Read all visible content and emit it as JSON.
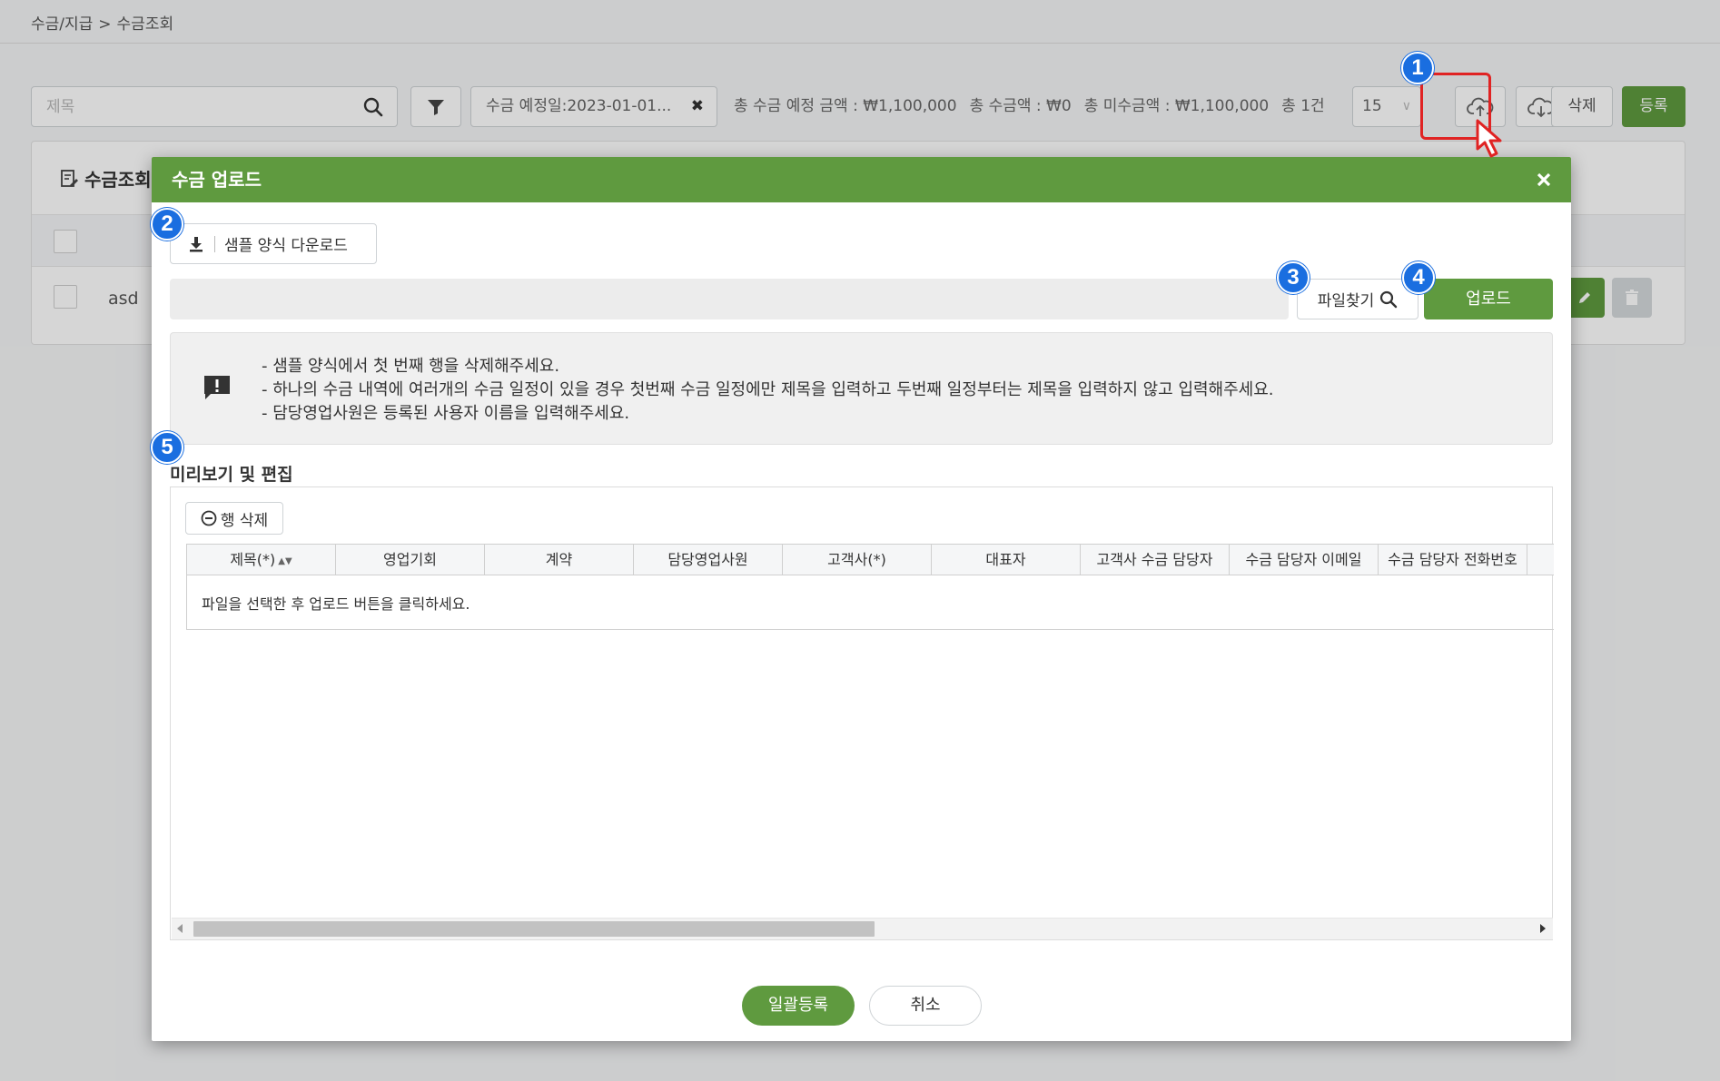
{
  "breadcrumb": {
    "parent": "수금/지급",
    "current": "수금조회"
  },
  "toolbar": {
    "search_placeholder": "제목",
    "filter_chip": "수금 예정일:2023-01-01...",
    "summary": {
      "expected_total": "총 수금 예정 금액 : ₩1,100,000",
      "received_total": "총 수금액 : ₩0",
      "outstanding_total": "총 미수금액 : ₩1,100,000",
      "count": "총 1건"
    },
    "page_size": "15",
    "delete_label": "삭제",
    "register_label": "등록"
  },
  "background_card": {
    "title": "수금조회",
    "row_text": "asd"
  },
  "modal": {
    "title": "수금 업로드",
    "sample_download_label": "샘플 양식 다운로드",
    "file_find_label": "파일찾기",
    "upload_label": "업로드",
    "notices": [
      "- 샘플 양식에서 첫 번째 행을 삭제해주세요.",
      "- 하나의 수금 내역에 여러개의 수금 일정이 있을 경우 첫번째 수금 일정에만 제목을 입력하고 두번째 일정부터는 제목을 입력하지 않고 입력해주세요.",
      "- 담당영업사원은 등록된 사용자 이름을 입력해주세요."
    ],
    "preview_title": "미리보기 및 편집",
    "row_delete_label": "행 삭제",
    "columns": [
      "제목(*)",
      "영업기회",
      "계약",
      "담당영업사원",
      "고객사(*)",
      "대표자",
      "고객사 수금 담당자",
      "수금 담당자 이메일",
      "수금 담당자 전화번호"
    ],
    "empty_message": "파일을 선택한 후 업로드 버튼을 클릭하세요.",
    "bulk_register_label": "일괄등록",
    "cancel_label": "취소"
  },
  "steps": [
    "1",
    "2",
    "3",
    "4",
    "5"
  ],
  "colors": {
    "primary_green": "#5f9a3f",
    "step_blue": "#1a6ee0",
    "highlight_red": "#e02323"
  }
}
